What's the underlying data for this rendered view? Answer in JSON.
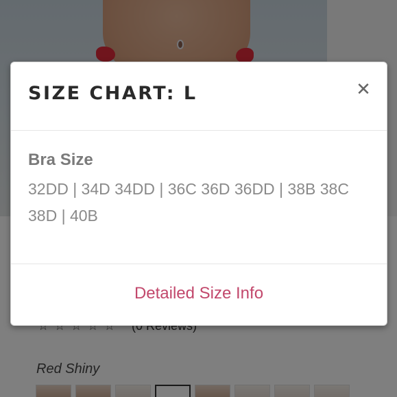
{
  "modal": {
    "title": "SIZE CHART: L",
    "close_glyph": "✕",
    "section_label": "Bra Size",
    "sizes_text": "32DD | 34D 34DD | 36C 36D 36DD | 38B 38C 38D | 40B",
    "footer_link": "Detailed Size Info"
  },
  "background": {
    "rating_stars": "☆ ☆ ☆ ☆ ☆",
    "reviews": "(0 Reviews)",
    "color_name": "Red Shiny",
    "swatch_count": 8,
    "selected_swatch_index": 3
  },
  "colors": {
    "link": "#c2486c",
    "overlay": "rgba(0,0,0,0.5)",
    "title": "#2a2a2a",
    "body_text": "#8a8a8a"
  },
  "icons": {
    "close": "close-icon",
    "star": "star-outline-icon"
  }
}
